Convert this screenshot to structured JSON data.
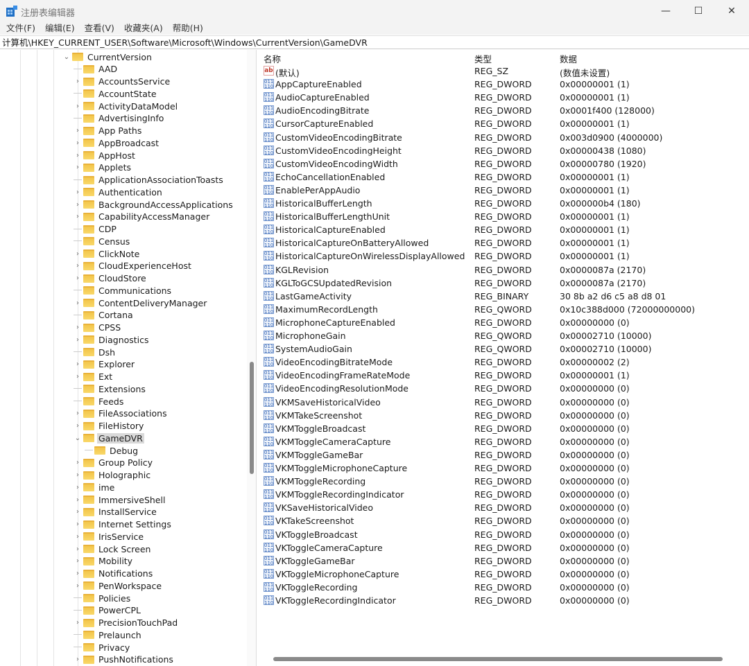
{
  "window": {
    "title": "注册表编辑器",
    "minimize": "—",
    "maximize": "☐",
    "close": "✕"
  },
  "menu": [
    "文件(F)",
    "编辑(E)",
    "查看(V)",
    "收藏夹(A)",
    "帮助(H)"
  ],
  "address": "计算机\\HKEY_CURRENT_USER\\Software\\Microsoft\\Windows\\CurrentVersion\\GameDVR",
  "tree": [
    {
      "label": "CurrentVersion",
      "level": 0,
      "state": "expanded"
    },
    {
      "label": "AAD",
      "level": 1,
      "state": "leaf"
    },
    {
      "label": "AccountsService",
      "level": 1,
      "state": "collapsed"
    },
    {
      "label": "AccountState",
      "level": 1,
      "state": "leaf"
    },
    {
      "label": "ActivityDataModel",
      "level": 1,
      "state": "collapsed"
    },
    {
      "label": "AdvertisingInfo",
      "level": 1,
      "state": "leaf"
    },
    {
      "label": "App Paths",
      "level": 1,
      "state": "collapsed"
    },
    {
      "label": "AppBroadcast",
      "level": 1,
      "state": "collapsed"
    },
    {
      "label": "AppHost",
      "level": 1,
      "state": "collapsed"
    },
    {
      "label": "Applets",
      "level": 1,
      "state": "collapsed"
    },
    {
      "label": "ApplicationAssociationToasts",
      "level": 1,
      "state": "leaf"
    },
    {
      "label": "Authentication",
      "level": 1,
      "state": "collapsed"
    },
    {
      "label": "BackgroundAccessApplications",
      "level": 1,
      "state": "collapsed"
    },
    {
      "label": "CapabilityAccessManager",
      "level": 1,
      "state": "collapsed"
    },
    {
      "label": "CDP",
      "level": 1,
      "state": "leaf"
    },
    {
      "label": "Census",
      "level": 1,
      "state": "leaf"
    },
    {
      "label": "ClickNote",
      "level": 1,
      "state": "collapsed"
    },
    {
      "label": "CloudExperienceHost",
      "level": 1,
      "state": "collapsed"
    },
    {
      "label": "CloudStore",
      "level": 1,
      "state": "collapsed"
    },
    {
      "label": "Communications",
      "level": 1,
      "state": "leaf"
    },
    {
      "label": "ContentDeliveryManager",
      "level": 1,
      "state": "collapsed"
    },
    {
      "label": "Cortana",
      "level": 1,
      "state": "leaf"
    },
    {
      "label": "CPSS",
      "level": 1,
      "state": "collapsed"
    },
    {
      "label": "Diagnostics",
      "level": 1,
      "state": "collapsed"
    },
    {
      "label": "Dsh",
      "level": 1,
      "state": "leaf"
    },
    {
      "label": "Explorer",
      "level": 1,
      "state": "collapsed"
    },
    {
      "label": "Ext",
      "level": 1,
      "state": "collapsed"
    },
    {
      "label": "Extensions",
      "level": 1,
      "state": "leaf"
    },
    {
      "label": "Feeds",
      "level": 1,
      "state": "leaf"
    },
    {
      "label": "FileAssociations",
      "level": 1,
      "state": "collapsed"
    },
    {
      "label": "FileHistory",
      "level": 1,
      "state": "collapsed"
    },
    {
      "label": "GameDVR",
      "level": 1,
      "state": "expanded",
      "selected": true
    },
    {
      "label": "Debug",
      "level": 2,
      "state": "leaf"
    },
    {
      "label": "Group Policy",
      "level": 1,
      "state": "collapsed"
    },
    {
      "label": "Holographic",
      "level": 1,
      "state": "collapsed"
    },
    {
      "label": "ime",
      "level": 1,
      "state": "collapsed"
    },
    {
      "label": "ImmersiveShell",
      "level": 1,
      "state": "collapsed"
    },
    {
      "label": "InstallService",
      "level": 1,
      "state": "collapsed"
    },
    {
      "label": "Internet Settings",
      "level": 1,
      "state": "collapsed"
    },
    {
      "label": "IrisService",
      "level": 1,
      "state": "collapsed"
    },
    {
      "label": "Lock Screen",
      "level": 1,
      "state": "collapsed"
    },
    {
      "label": "Mobility",
      "level": 1,
      "state": "collapsed"
    },
    {
      "label": "Notifications",
      "level": 1,
      "state": "collapsed"
    },
    {
      "label": "PenWorkspace",
      "level": 1,
      "state": "collapsed"
    },
    {
      "label": "Policies",
      "level": 1,
      "state": "leaf"
    },
    {
      "label": "PowerCPL",
      "level": 1,
      "state": "leaf"
    },
    {
      "label": "PrecisionTouchPad",
      "level": 1,
      "state": "collapsed"
    },
    {
      "label": "Prelaunch",
      "level": 1,
      "state": "leaf"
    },
    {
      "label": "Privacy",
      "level": 1,
      "state": "leaf"
    },
    {
      "label": "PushNotifications",
      "level": 1,
      "state": "collapsed"
    }
  ],
  "columns": {
    "name": "名称",
    "type": "类型",
    "data": "数据"
  },
  "icons": {
    "string": "ab",
    "binary": "011\n110"
  },
  "values": [
    {
      "name": "(默认)",
      "type": "REG_SZ",
      "data": "(数值未设置)",
      "icon": "string"
    },
    {
      "name": "AppCaptureEnabled",
      "type": "REG_DWORD",
      "data": "0x00000001 (1)"
    },
    {
      "name": "AudioCaptureEnabled",
      "type": "REG_DWORD",
      "data": "0x00000001 (1)"
    },
    {
      "name": "AudioEncodingBitrate",
      "type": "REG_DWORD",
      "data": "0x0001f400 (128000)"
    },
    {
      "name": "CursorCaptureEnabled",
      "type": "REG_DWORD",
      "data": "0x00000001 (1)"
    },
    {
      "name": "CustomVideoEncodingBitrate",
      "type": "REG_DWORD",
      "data": "0x003d0900 (4000000)"
    },
    {
      "name": "CustomVideoEncodingHeight",
      "type": "REG_DWORD",
      "data": "0x00000438 (1080)"
    },
    {
      "name": "CustomVideoEncodingWidth",
      "type": "REG_DWORD",
      "data": "0x00000780 (1920)"
    },
    {
      "name": "EchoCancellationEnabled",
      "type": "REG_DWORD",
      "data": "0x00000001 (1)"
    },
    {
      "name": "EnablePerAppAudio",
      "type": "REG_DWORD",
      "data": "0x00000001 (1)"
    },
    {
      "name": "HistoricalBufferLength",
      "type": "REG_DWORD",
      "data": "0x000000b4 (180)"
    },
    {
      "name": "HistoricalBufferLengthUnit",
      "type": "REG_DWORD",
      "data": "0x00000001 (1)"
    },
    {
      "name": "HistoricalCaptureEnabled",
      "type": "REG_DWORD",
      "data": "0x00000001 (1)"
    },
    {
      "name": "HistoricalCaptureOnBatteryAllowed",
      "type": "REG_DWORD",
      "data": "0x00000001 (1)"
    },
    {
      "name": "HistoricalCaptureOnWirelessDisplayAllowed",
      "type": "REG_DWORD",
      "data": "0x00000001 (1)"
    },
    {
      "name": "KGLRevision",
      "type": "REG_DWORD",
      "data": "0x0000087a (2170)"
    },
    {
      "name": "KGLToGCSUpdatedRevision",
      "type": "REG_DWORD",
      "data": "0x0000087a (2170)"
    },
    {
      "name": "LastGameActivity",
      "type": "REG_BINARY",
      "data": "30 8b a2 d6 c5 a8 d8 01"
    },
    {
      "name": "MaximumRecordLength",
      "type": "REG_QWORD",
      "data": "0x10c388d000 (72000000000)"
    },
    {
      "name": "MicrophoneCaptureEnabled",
      "type": "REG_DWORD",
      "data": "0x00000000 (0)"
    },
    {
      "name": "MicrophoneGain",
      "type": "REG_QWORD",
      "data": "0x00002710 (10000)"
    },
    {
      "name": "SystemAudioGain",
      "type": "REG_QWORD",
      "data": "0x00002710 (10000)"
    },
    {
      "name": "VideoEncodingBitrateMode",
      "type": "REG_DWORD",
      "data": "0x00000002 (2)"
    },
    {
      "name": "VideoEncodingFrameRateMode",
      "type": "REG_DWORD",
      "data": "0x00000001 (1)"
    },
    {
      "name": "VideoEncodingResolutionMode",
      "type": "REG_DWORD",
      "data": "0x00000000 (0)"
    },
    {
      "name": "VKMSaveHistoricalVideo",
      "type": "REG_DWORD",
      "data": "0x00000000 (0)"
    },
    {
      "name": "VKMTakeScreenshot",
      "type": "REG_DWORD",
      "data": "0x00000000 (0)"
    },
    {
      "name": "VKMToggleBroadcast",
      "type": "REG_DWORD",
      "data": "0x00000000 (0)"
    },
    {
      "name": "VKMToggleCameraCapture",
      "type": "REG_DWORD",
      "data": "0x00000000 (0)"
    },
    {
      "name": "VKMToggleGameBar",
      "type": "REG_DWORD",
      "data": "0x00000000 (0)"
    },
    {
      "name": "VKMToggleMicrophoneCapture",
      "type": "REG_DWORD",
      "data": "0x00000000 (0)"
    },
    {
      "name": "VKMToggleRecording",
      "type": "REG_DWORD",
      "data": "0x00000000 (0)"
    },
    {
      "name": "VKMToggleRecordingIndicator",
      "type": "REG_DWORD",
      "data": "0x00000000 (0)"
    },
    {
      "name": "VKSaveHistoricalVideo",
      "type": "REG_DWORD",
      "data": "0x00000000 (0)"
    },
    {
      "name": "VKTakeScreenshot",
      "type": "REG_DWORD",
      "data": "0x00000000 (0)"
    },
    {
      "name": "VKToggleBroadcast",
      "type": "REG_DWORD",
      "data": "0x00000000 (0)"
    },
    {
      "name": "VKToggleCameraCapture",
      "type": "REG_DWORD",
      "data": "0x00000000 (0)"
    },
    {
      "name": "VKToggleGameBar",
      "type": "REG_DWORD",
      "data": "0x00000000 (0)"
    },
    {
      "name": "VKToggleMicrophoneCapture",
      "type": "REG_DWORD",
      "data": "0x00000000 (0)"
    },
    {
      "name": "VKToggleRecording",
      "type": "REG_DWORD",
      "data": "0x00000000 (0)"
    },
    {
      "name": "VKToggleRecordingIndicator",
      "type": "REG_DWORD",
      "data": "0x00000000 (0)"
    }
  ]
}
